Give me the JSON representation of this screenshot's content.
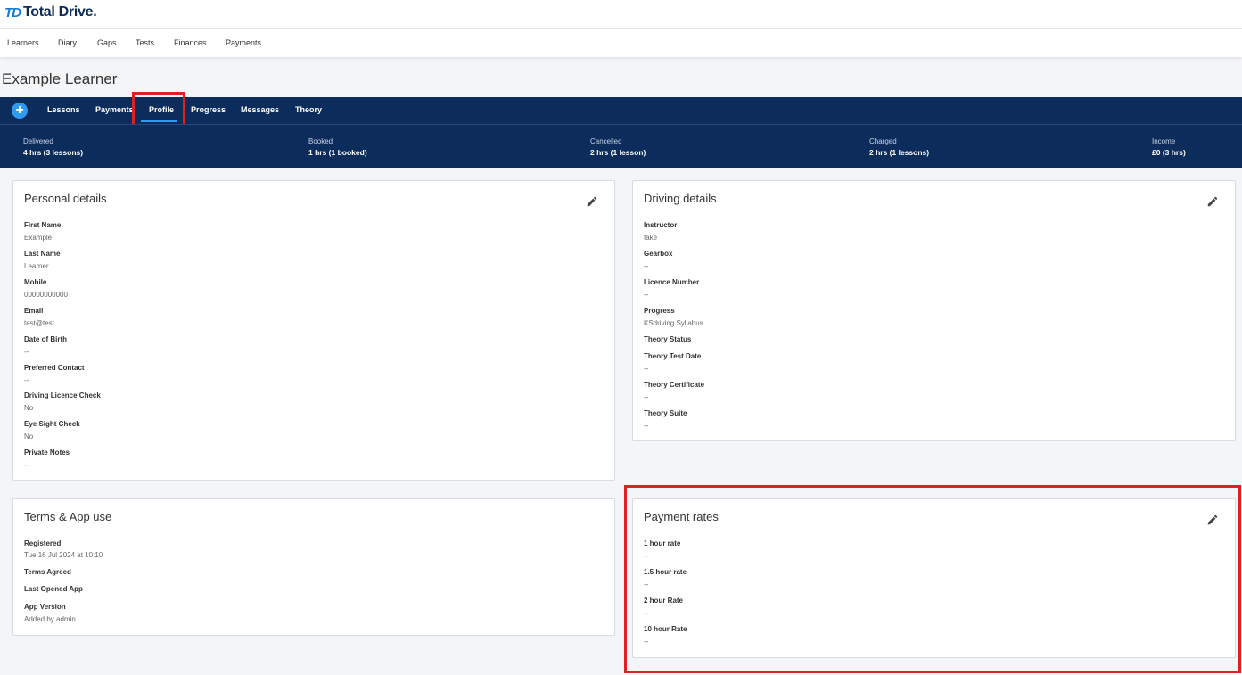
{
  "brand": {
    "mark": "TD",
    "name": "Total Drive."
  },
  "main_nav": [
    "Learners",
    "Diary",
    "Gaps",
    "Tests",
    "Finances",
    "Payments"
  ],
  "page_title": "Example Learner",
  "tabs": {
    "add_symbol": "+",
    "items": [
      "Lessons",
      "Payments",
      "Profile",
      "Progress",
      "Messages",
      "Theory"
    ],
    "active": "Profile"
  },
  "stats": [
    {
      "label": "Delivered",
      "value": "4 hrs (3 lessons)"
    },
    {
      "label": "Booked",
      "value": "1 hrs (1 booked)"
    },
    {
      "label": "Cancelled",
      "value": "2 hrs (1 lesson)"
    },
    {
      "label": "Charged",
      "value": "2 hrs (1 lessons)"
    },
    {
      "label": "Income",
      "value": "£0 (3 hrs)"
    }
  ],
  "personal": {
    "title": "Personal details",
    "fields": [
      {
        "label": "First Name",
        "value": "Example"
      },
      {
        "label": "Last Name",
        "value": "Learner"
      },
      {
        "label": "Mobile",
        "value": "00000000000"
      },
      {
        "label": "Email",
        "value": "test@test"
      },
      {
        "label": "Date of Birth",
        "value": "--"
      },
      {
        "label": "Preferred Contact",
        "value": "--"
      },
      {
        "label": "Driving Licence Check",
        "value": "No"
      },
      {
        "label": "Eye Sight Check",
        "value": "No"
      },
      {
        "label": "Private Notes",
        "value": "--"
      }
    ]
  },
  "driving": {
    "title": "Driving details",
    "fields": [
      {
        "label": "Instructor",
        "value": "fake"
      },
      {
        "label": "Gearbox",
        "value": "--"
      },
      {
        "label": "Licence Number",
        "value": "--"
      },
      {
        "label": "Progress",
        "value": "KSdriving Syllabus"
      },
      {
        "label": "Theory Status",
        "value": ""
      },
      {
        "label": "Theory Test Date",
        "value": "--"
      },
      {
        "label": "Theory Certificate",
        "value": "--"
      },
      {
        "label": "Theory Suite",
        "value": "--"
      }
    ]
  },
  "terms": {
    "title": "Terms & App use",
    "fields": [
      {
        "label": "Registered",
        "value": "Tue 16 Jul 2024 at 10:10"
      },
      {
        "label": "Terms Agreed",
        "value": ""
      },
      {
        "label": "Last Opened App",
        "value": ""
      },
      {
        "label": "App Version",
        "value": "Added by admin"
      }
    ]
  },
  "rates": {
    "title": "Payment rates",
    "fields": [
      {
        "label": "1 hour rate",
        "value": "--"
      },
      {
        "label": "1.5 hour rate",
        "value": "--"
      },
      {
        "label": "2 hour Rate",
        "value": "--"
      },
      {
        "label": "10 hour Rate",
        "value": "--"
      }
    ]
  },
  "icons": {
    "edit": "pencil-icon",
    "add": "plus-icon"
  },
  "colors": {
    "navy": "#0c2c5c",
    "accent": "#2e9bf0",
    "highlight": "#e02020"
  }
}
